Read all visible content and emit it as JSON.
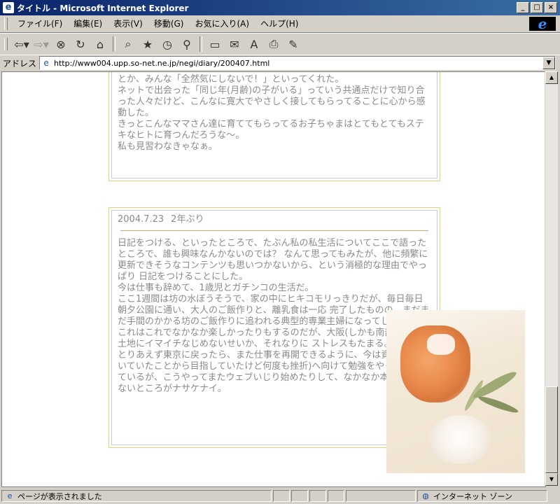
{
  "window": {
    "title": "タイトル - Microsoft Internet Explorer",
    "minimize": "_",
    "maximize": "□",
    "close": "×"
  },
  "menu": {
    "items": [
      "ファイル(F)",
      "編集(E)",
      "表示(V)",
      "移動(G)",
      "お気に入り(A)",
      "ヘルプ(H)"
    ]
  },
  "toolbar": {
    "icons": [
      "back-arrow-icon",
      "forward-arrow-icon",
      "stop-icon",
      "refresh-icon",
      "home-icon",
      "search-icon",
      "favorites-icon",
      "history-icon",
      "channels-icon",
      "fullscreen-icon",
      "mail-icon",
      "font-icon",
      "print-icon",
      "edit-icon"
    ]
  },
  "address": {
    "label": "アドレス",
    "url": "http://www004.upp.so-net.ne.jp/negi/diary/200407.html"
  },
  "entries": [
    {
      "lines": [
        "い出になる」とか「言うの辛かっただろうけど、知らせてくれてありがとう」とか、みんな「全然気にしないで！」といってくれた。",
        "ネットで出会った「同じ年(月齢)の子がいる」っていう共通点だけで知り合った人々だけど、こんなに寛大でやさしく接してもらってることに心から感動した。",
        "きっとこんなママさん達に育ててもらってるお子ちゃまはとてもとてもステキなヒトに育つんだろうな～。",
        "私も見習わなきゃなぁ。"
      ]
    },
    {
      "date": "2004.7.23",
      "title": "2年ぶり",
      "lines": [
        "日記をつける、といったところで、たぶん私の私生活についてここで語ったところで、誰も興味なんかないのでは？ なんて思ってもみたが、他に頻繁に更新できそうなコンテンツも思いつかないから、という消極的な理由でやっぱり 日記をつけることにした。",
        "今は仕事も辞めて、1歳児とガチンコの生活だ。",
        "ここ1週間は坊の水ぼうそうで、家の中にヒキコモリっきりだが、毎日毎日朝夕公園に通い、大人のご飯作りと、離乳食は一応 完了したものの、まだまだ手間のかかる坊のご飯作りに追われる典型的専業主婦になってしまった。",
        "これはこれでなかなか楽しかったりもするのだが、大阪(しかも南部)という土地にイマイチなじめないせいか、それなりに ストレスもたまる。",
        "とりあえず東京に戻ったら、また仕事を再開できるように、今は資格取得(働いていたことから目指していたけど何度も挫折)へ向けて勉強をやったりもしているが、こうやってまたウェブいじり始めたりして、なかなか本腰が入らないところがナサケナイ。"
      ]
    }
  ],
  "status": {
    "text": "ページが表示されました",
    "zone": "インターネット ゾーン"
  },
  "colors": {
    "box_border": "#e8cf7a",
    "rule": "#e0a070",
    "text": "#8a8a8a"
  }
}
